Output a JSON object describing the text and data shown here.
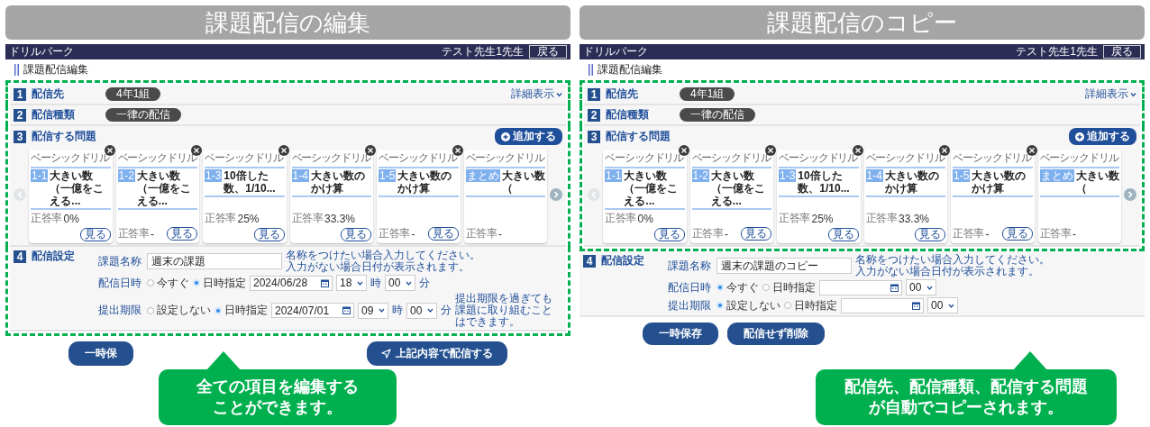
{
  "panels": [
    {
      "banner": "課題配信の編集",
      "header": {
        "app_name": "ドリルパーク",
        "user": "テスト先生1先生",
        "back": "戻る"
      },
      "page_title": "課題配信編集",
      "sections": [
        {
          "kind": "target",
          "number": "1",
          "label": "配信先",
          "highlighted": true,
          "chip": "4年1組",
          "link": "詳細表示"
        },
        {
          "kind": "type",
          "number": "2",
          "label": "配信種類",
          "highlighted": true,
          "chip": "一律の配信"
        },
        {
          "kind": "problems",
          "number": "3",
          "label": "配信する問題",
          "highlighted": true,
          "add": "追加する",
          "cards": [
            {
              "category": "ベーシックドリル",
              "tag": "1-1",
              "title": "大きい数（一億をこえる...",
              "rate_label": "正答率",
              "rate": "0%",
              "view": "見る"
            },
            {
              "category": "ベーシックドリル",
              "tag": "1-2",
              "title": "大きい数（一億をこえる...",
              "rate_label": "正答率",
              "rate": "-",
              "view": "見る"
            },
            {
              "category": "ベーシックドリル",
              "tag": "1-3",
              "title": "10倍した数、1/10...",
              "rate_label": "正答率",
              "rate": "25%",
              "view": "見る"
            },
            {
              "category": "ベーシックドリル",
              "tag": "1-4",
              "title": "大きい数のかけ算",
              "rate_label": "正答率",
              "rate": "33.3%",
              "view": "見る"
            },
            {
              "category": "ベーシックドリル",
              "tag": "1-5",
              "title": "大きい数のかけ算",
              "rate_label": "正答率",
              "rate": "-",
              "view": "見る"
            },
            {
              "category": "ベーシックドリル",
              "tag": "まとめ",
              "title": "大きい数（",
              "rate_label": "正答率",
              "rate": "-"
            }
          ]
        },
        {
          "kind": "settings",
          "number": "4",
          "label": "配信設定",
          "highlighted": true,
          "name_label": "課題名称",
          "name_value": "週末の課題",
          "name_hint": [
            "名称をつけたい場合入力してください。",
            "入力がない場合日付が表示されます。"
          ],
          "rows": [
            {
              "label": "配信日時",
              "options": [
                {
                  "label": "今すぐ",
                  "selected": false
                },
                {
                  "label": "日時指定",
                  "selected": true
                }
              ],
              "date": "2024/06/28",
              "hour": "18",
              "hour_unit": "時",
              "minute": "00",
              "minute_unit": "分"
            },
            {
              "label": "提出期限",
              "options": [
                {
                  "label": "設定しない",
                  "selected": false
                },
                {
                  "label": "日時指定",
                  "selected": true
                }
              ],
              "date": "2024/07/01",
              "hour": "09",
              "hour_unit": "時",
              "minute": "00",
              "minute_unit": "分",
              "hint": [
                "提出期限を過ぎても",
                "課題に取り組むことはできます。"
              ]
            }
          ]
        }
      ],
      "buttons": [
        {
          "kind": "plain",
          "label": "一時保"
        },
        {
          "kind": "send",
          "label": "上記内容で配信する"
        }
      ],
      "callout": [
        "全ての項目を編集する",
        "ことができます。"
      ]
    },
    {
      "banner": "課題配信のコピー",
      "header": {
        "app_name": "ドリルパーク",
        "user": "テスト先生1先生",
        "back": "戻る"
      },
      "page_title": "課題配信編集",
      "sections": [
        {
          "kind": "target",
          "number": "1",
          "label": "配信先",
          "highlighted": true,
          "chip": "4年1組",
          "link": "詳細表示"
        },
        {
          "kind": "type",
          "number": "2",
          "label": "配信種類",
          "highlighted": true,
          "chip": "一律の配信"
        },
        {
          "kind": "problems",
          "number": "3",
          "label": "配信する問題",
          "highlighted": true,
          "add": "追加する",
          "cards": [
            {
              "category": "ベーシックドリル",
              "tag": "1-1",
              "title": "大きい数（一億をこえる...",
              "rate_label": "正答率",
              "rate": "0%",
              "view": "見る"
            },
            {
              "category": "ベーシックドリル",
              "tag": "1-2",
              "title": "大きい数（一億をこえる...",
              "rate_label": "正答率",
              "rate": "-",
              "view": "見る"
            },
            {
              "category": "ベーシックドリル",
              "tag": "1-3",
              "title": "10倍した数、1/10...",
              "rate_label": "正答率",
              "rate": "25%",
              "view": "見る"
            },
            {
              "category": "ベーシックドリル",
              "tag": "1-4",
              "title": "大きい数のかけ算",
              "rate_label": "正答率",
              "rate": "33.3%",
              "view": "見る"
            },
            {
              "category": "ベーシックドリル",
              "tag": "1-5",
              "title": "大きい数のかけ算",
              "rate_label": "正答率",
              "rate": "-",
              "view": "見る"
            },
            {
              "category": "ベーシックドリル",
              "tag": "まとめ",
              "title": "大きい数（",
              "rate_label": "正答率",
              "rate": "-"
            }
          ]
        },
        {
          "kind": "settings",
          "number": "4",
          "label": "配信設定",
          "highlighted": false,
          "name_label": "課題名称",
          "name_value": "週末の課題のコピー",
          "name_hint": [
            "名称をつけたい場合入力してください。",
            "入力がない場合日付が表示されます。"
          ],
          "rows": [
            {
              "label": "配信日時",
              "options": [
                {
                  "label": "今すぐ",
                  "selected": true
                },
                {
                  "label": "日時指定",
                  "selected": false
                }
              ],
              "hour": "00"
            },
            {
              "label": "提出期限",
              "options": [
                {
                  "label": "設定しない",
                  "selected": true
                },
                {
                  "label": "日時指定",
                  "selected": false
                }
              ],
              "hour": "00"
            }
          ]
        }
      ],
      "buttons": [
        {
          "kind": "plain",
          "label": "一時保存"
        },
        {
          "kind": "plain",
          "label": "配信せず削除"
        }
      ],
      "callout": [
        "配信先、配信種類、配信する問題",
        "が自動でコピーされます。"
      ]
    }
  ]
}
